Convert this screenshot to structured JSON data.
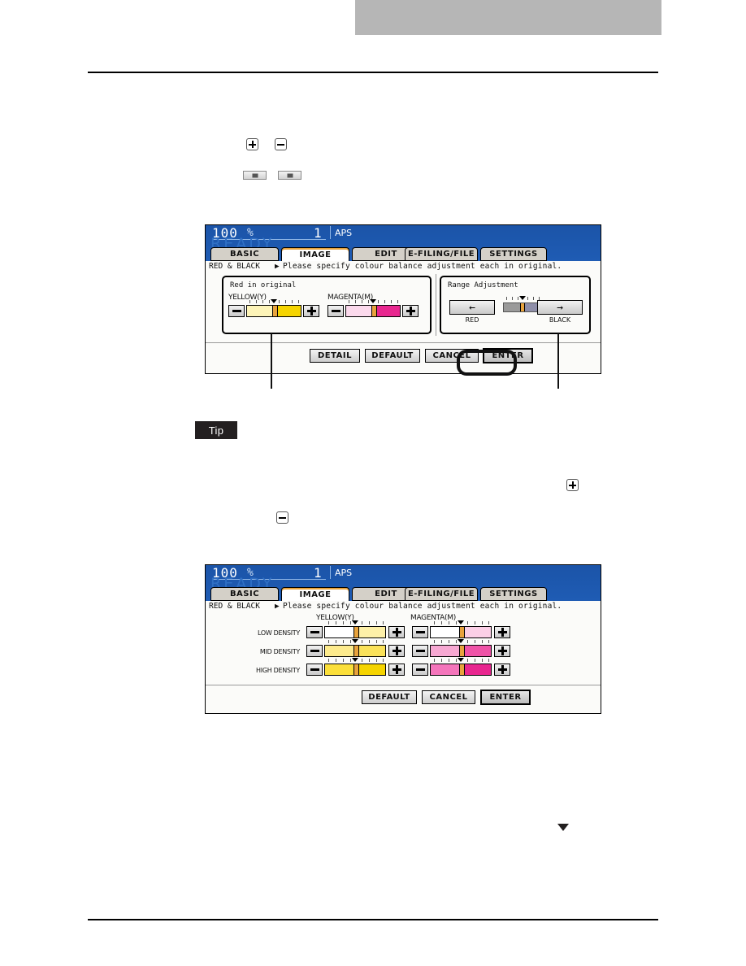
{
  "document": {
    "header_block_color": "#b6b6b6",
    "tip_label": "Tip",
    "inline_icons": [
      {
        "name": "plus-box-icon",
        "glyph": "+"
      },
      {
        "name": "minus-box-icon",
        "glyph": "-"
      },
      {
        "name": "left-arrow-button-icon",
        "glyph": "◀"
      },
      {
        "name": "right-arrow-button-icon",
        "glyph": "▶"
      },
      {
        "name": "plus-box-icon-2",
        "glyph": "+"
      },
      {
        "name": "minus-box-icon-2",
        "glyph": "-"
      },
      {
        "name": "down-triangle-marker",
        "glyph": "▼"
      }
    ]
  },
  "panel1": {
    "status": {
      "zoom": "100",
      "percent": "%",
      "copies": "1",
      "paper": "APS",
      "ready": "READY"
    },
    "tabs": [
      {
        "label": "BASIC",
        "active": false
      },
      {
        "label": "IMAGE",
        "active": true
      },
      {
        "label": "EDIT",
        "active": false
      },
      {
        "label": "E-FILING/FILE",
        "active": false
      },
      {
        "label": "SETTINGS",
        "active": false
      }
    ],
    "message": {
      "mode": "RED & BLACK",
      "arrow": "▶",
      "text": "Please specify colour balance adjustment each in original."
    },
    "left_group": {
      "title": "Red in original",
      "columns": [
        {
          "label": "YELLOW(Y)",
          "minus": "-",
          "plus": "+",
          "value": 0,
          "ticks": 9
        },
        {
          "label": "MAGENTA(M)",
          "minus": "-",
          "plus": "+",
          "value": 0,
          "ticks": 9
        }
      ]
    },
    "right_group": {
      "title": "Range Adjustment",
      "left_button": "←",
      "right_button": "→",
      "left_caption": "RED",
      "right_caption": "BLACK",
      "value": 0,
      "ticks": 7
    },
    "buttons": [
      {
        "label": "DETAIL",
        "selected": false
      },
      {
        "label": "DEFAULT",
        "selected": false
      },
      {
        "label": "CANCEL",
        "selected": false
      },
      {
        "label": "ENTER",
        "selected": true
      }
    ]
  },
  "panel2": {
    "status": {
      "zoom": "100",
      "percent": "%",
      "copies": "1",
      "paper": "APS",
      "ready": "READY"
    },
    "tabs": [
      {
        "label": "BASIC",
        "active": false
      },
      {
        "label": "IMAGE",
        "active": true
      },
      {
        "label": "EDIT",
        "active": false
      },
      {
        "label": "E-FILING/FILE",
        "active": false
      },
      {
        "label": "SETTINGS",
        "active": false
      }
    ],
    "message": {
      "mode": "RED & BLACK",
      "arrow": "▶",
      "text": "Please specify colour balance adjustment each in original."
    },
    "column_headers": [
      "YELLOW(Y)",
      "MAGENTA(M)"
    ],
    "row_labels": [
      "LOW DENSITY",
      "MID DENSITY",
      "HIGH DENSITY"
    ],
    "minus_label": "-",
    "plus_label": "+",
    "sliders": [
      {
        "row": "LOW DENSITY",
        "yellow": 0,
        "magenta": 0
      },
      {
        "row": "MID DENSITY",
        "yellow": 0,
        "magenta": 0
      },
      {
        "row": "HIGH DENSITY",
        "yellow": 0,
        "magenta": 0
      }
    ],
    "buttons": [
      {
        "label": "DEFAULT",
        "selected": false
      },
      {
        "label": "CANCEL",
        "selected": false
      },
      {
        "label": "ENTER",
        "selected": true
      }
    ]
  },
  "colors": {
    "lcd_header_blue": "#1d58ad",
    "tab_active_accent": "#e8a33d",
    "yellow_slider": "#f5d400",
    "magenta_slider": "#e8268f",
    "knob": "#e8a33d",
    "callout": "#111111"
  }
}
